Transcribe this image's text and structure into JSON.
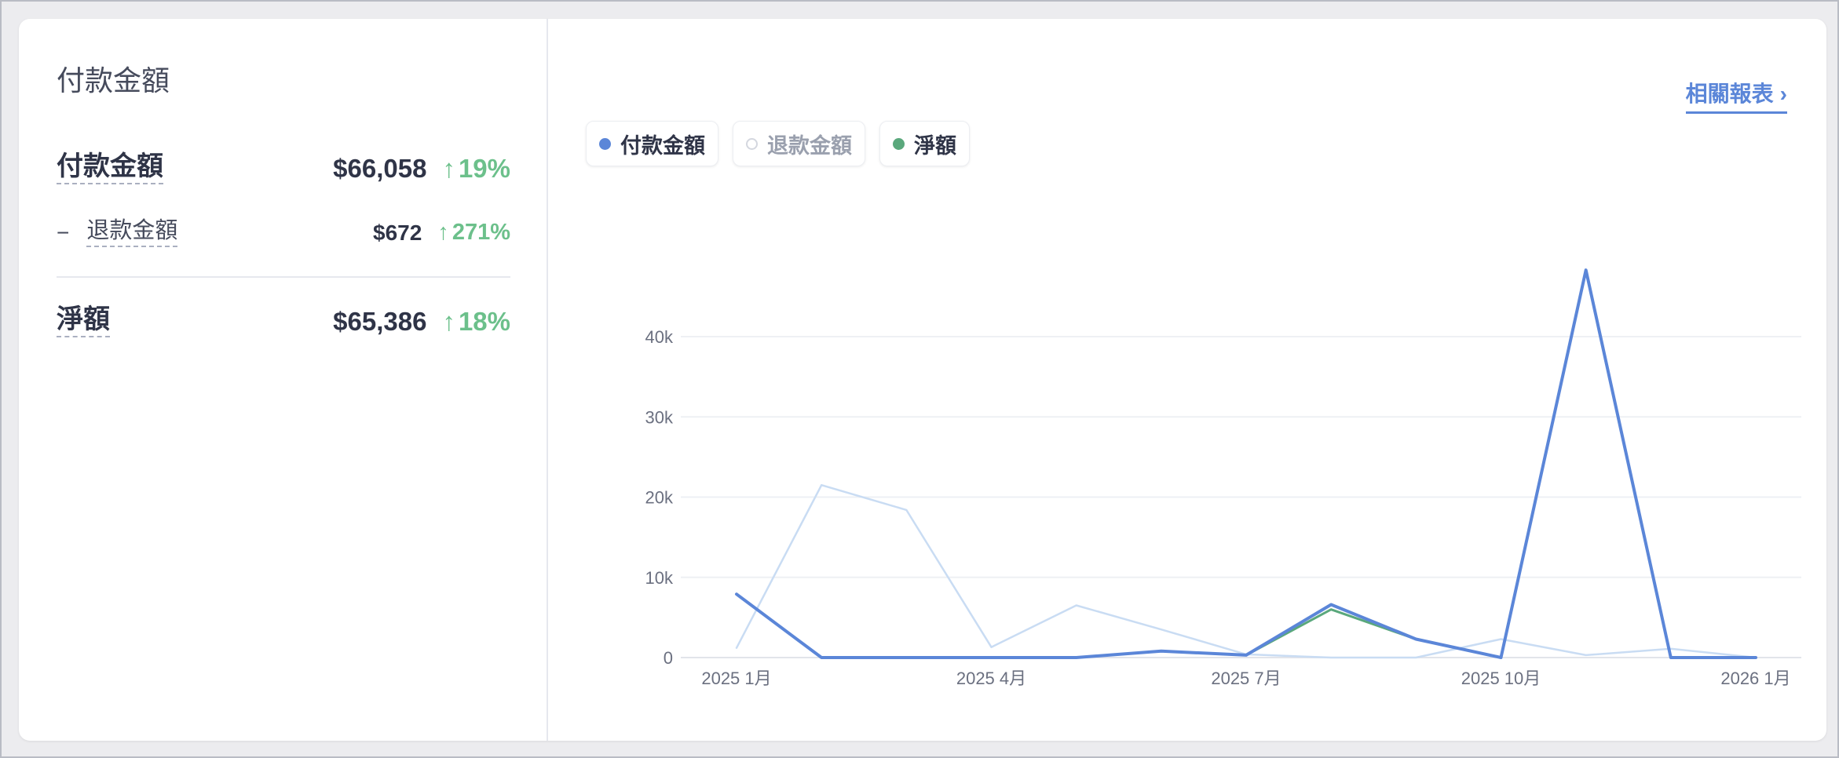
{
  "summary": {
    "title": "付款金額",
    "rows": [
      {
        "label": "付款金額",
        "amount": "$66,058",
        "change": "19%"
      },
      {
        "prefix": "−",
        "label": "退款金額",
        "amount": "$672",
        "change": "271%"
      },
      {
        "label": "淨額",
        "amount": "$65,386",
        "change": "18%"
      }
    ]
  },
  "report_link": {
    "label": "相關報表",
    "chevron": "›"
  },
  "legend": [
    {
      "label": "付款金額",
      "color": "#5b86d8",
      "active": true
    },
    {
      "label": "退款金額",
      "color": "#c7cbd6",
      "active": false
    },
    {
      "label": "淨額",
      "color": "#5aa87c",
      "active": true
    }
  ],
  "colors": {
    "payment": "#5b86d8",
    "net": "#5aa87c",
    "comparison": "#c9dcf3",
    "positive_change": "#6cc08b"
  },
  "chart_data": {
    "type": "line",
    "x": [
      "2025-01",
      "2025-02",
      "2025-03",
      "2025-04",
      "2025-05",
      "2025-06",
      "2025-07",
      "2025-08",
      "2025-09",
      "2025-10",
      "2025-11",
      "2025-12",
      "2026-01"
    ],
    "x_tick_labels": [
      {
        "x": "2025-01",
        "label": "2025 1月"
      },
      {
        "x": "2025-04",
        "label": "2025 4月"
      },
      {
        "x": "2025-07",
        "label": "2025 7月"
      },
      {
        "x": "2025-10",
        "label": "2025 10月"
      },
      {
        "x": "2026-01",
        "label": "2026 1月"
      }
    ],
    "y_ticks": [
      0,
      10000,
      20000,
      30000,
      40000
    ],
    "y_tick_labels": [
      "0",
      "10k",
      "20k",
      "30k",
      "40k"
    ],
    "ylim": [
      0,
      49000
    ],
    "grid": true,
    "series": [
      {
        "key": "comparison",
        "values": [
          1200,
          21500,
          18400,
          1300,
          6500,
          3500,
          400,
          0,
          0,
          2300,
          300,
          1100,
          0
        ]
      },
      {
        "name": "淨額",
        "key": "net",
        "values": [
          7900,
          0,
          0,
          0,
          0,
          800,
          300,
          6000,
          2300,
          0,
          48300,
          0,
          0
        ]
      },
      {
        "name": "付款金額",
        "key": "payment",
        "values": [
          7900,
          0,
          0,
          0,
          0,
          800,
          300,
          6600,
          2300,
          0,
          48300,
          0,
          0
        ]
      }
    ]
  }
}
